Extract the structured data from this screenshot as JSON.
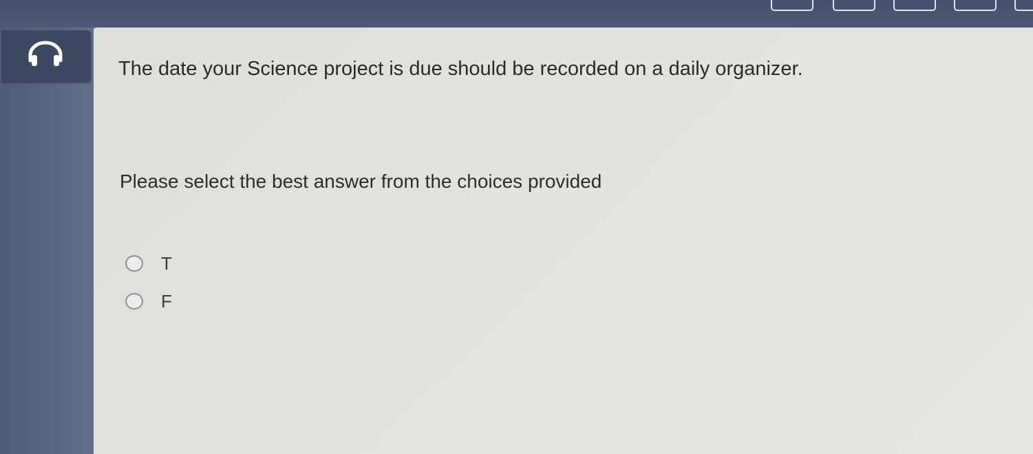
{
  "question": {
    "text": "The date your Science project is due should be recorded on a daily organizer."
  },
  "instruction": {
    "text": "Please select the best answer from the choices provided"
  },
  "choices": [
    {
      "label": "T"
    },
    {
      "label": "F"
    }
  ],
  "icons": {
    "audio": "headphones-icon",
    "radio": "radio-unselected-icon"
  },
  "colors": {
    "background": "#4a5670",
    "card": "#e3e3de",
    "text": "#2a2a2a"
  }
}
